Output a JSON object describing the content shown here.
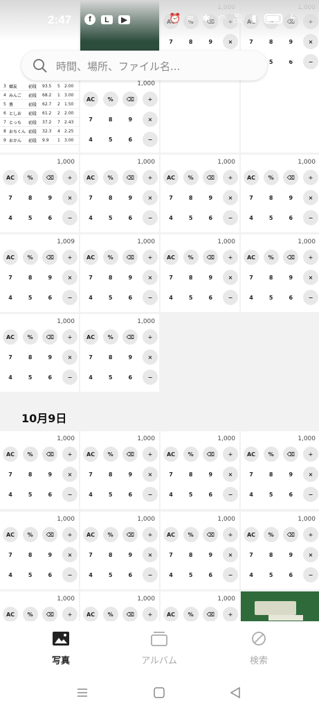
{
  "status": {
    "time": "2:47",
    "app_icons": [
      "facebook-icon",
      "line-icon",
      "youtube-icon"
    ],
    "network_label": "Vo LTE"
  },
  "search": {
    "placeholder": "時間、場所、ファイル名..."
  },
  "section": {
    "date": "10月9日"
  },
  "calc": {
    "rows": [
      [
        "AC",
        "%",
        "⌫",
        "÷"
      ],
      [
        "7",
        "8",
        "9",
        "×"
      ],
      [
        "4",
        "5",
        "6",
        "−"
      ]
    ],
    "default_value": "1,000",
    "alt_value": "1,009"
  },
  "score_table": {
    "rows": [
      [
        "3",
        "郷友",
        "初段",
        "93.5",
        "5",
        "2.00"
      ],
      [
        "4",
        "みんご",
        "初段",
        "68.2",
        "1",
        "3.00"
      ],
      [
        "5",
        "貴",
        "初段",
        "62.7",
        "2",
        "1.50"
      ],
      [
        "6",
        "としお",
        "初段",
        "61.2",
        "2",
        "2.00"
      ],
      [
        "7",
        "とっち",
        "初段",
        "37.2",
        "7",
        "2.43"
      ],
      [
        "8",
        "おちくん",
        "初段",
        "32.3",
        "4",
        "2.25"
      ],
      [
        "9",
        "おかん",
        "初段",
        "9.9",
        "1",
        "3.00"
      ]
    ]
  },
  "nav": {
    "photos": "写真",
    "albums": "アルバム",
    "search": "検索"
  },
  "colors": {
    "accent": "#222222",
    "inactive": "#aaaaaa",
    "calc_key_bg": "#e8e8e8"
  }
}
